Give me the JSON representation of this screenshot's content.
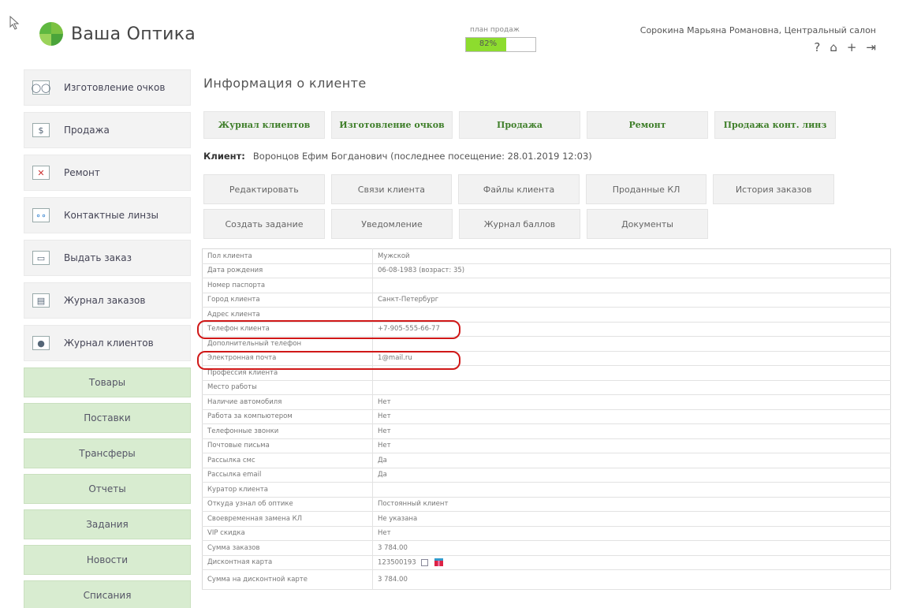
{
  "app": {
    "title": "Ваша Оптика"
  },
  "plan": {
    "label": "план продаж",
    "percent_text": "82%",
    "percent": 0.82
  },
  "user": {
    "name": "Сорокина Марьяна Романовна, Центральный салон"
  },
  "header_icons": [
    "help-icon",
    "home-icon",
    "plus-icon",
    "logout-icon"
  ],
  "sidebar": {
    "items": [
      {
        "label": "Изготовление очков",
        "icon": "glasses-icon",
        "glyph": "◯◯"
      },
      {
        "label": "Продажа",
        "icon": "sale-icon",
        "glyph": "$"
      },
      {
        "label": "Ремонт",
        "icon": "repair-icon",
        "glyph": "✕"
      },
      {
        "label": "Контактные линзы",
        "icon": "lens-icon",
        "glyph": "∘∘"
      },
      {
        "label": "Выдать заказ",
        "icon": "order-out-icon",
        "glyph": "▭"
      },
      {
        "label": "Журнал заказов",
        "icon": "orders-log-icon",
        "glyph": "▤"
      },
      {
        "label": "Журнал клиентов",
        "icon": "clients-log-icon",
        "glyph": "●"
      }
    ],
    "green_items": [
      "Товары",
      "Поставки",
      "Трансферы",
      "Отчеты",
      "Задания",
      "Новости",
      "Списания"
    ]
  },
  "main": {
    "title": "Информация о клиенте",
    "tabs": [
      "Журнал клиентов",
      "Изготовление очков",
      "Продажа",
      "Ремонт",
      "Продажа конт. линз"
    ],
    "client_label": "Клиент:",
    "client_text": "Воронцов Ефим Богданович (последнее посещение: 28.01.2019 12:03)",
    "actions_row1": [
      "Редактировать",
      "Связи клиента",
      "Файлы клиента",
      "Проданные КЛ",
      "История заказов"
    ],
    "actions_row2": [
      "Создать задание",
      "Уведомление",
      "Журнал баллов",
      "Документы"
    ]
  },
  "info_rows": [
    {
      "key": "Пол клиента",
      "value": "Мужской"
    },
    {
      "key": "Дата рождения",
      "value": "06-08-1983 (возраст: 35)"
    },
    {
      "key": "Номер паспорта",
      "value": ""
    },
    {
      "key": "Город клиента",
      "value": "Санкт-Петербург"
    },
    {
      "key": "Адрес клиента",
      "value": ""
    },
    {
      "key": "Телефон клиента",
      "value": "+7-905-555-66-77"
    },
    {
      "key": "Дополнительный телефон",
      "value": ""
    },
    {
      "key": "Электронная почта",
      "value": "1@mail.ru"
    },
    {
      "key": "Профессия клиента",
      "value": ""
    },
    {
      "key": "Место работы",
      "value": ""
    },
    {
      "key": "Наличие автомобиля",
      "value": "Нет"
    },
    {
      "key": "Работа за компьютером",
      "value": "Нет"
    },
    {
      "key": "Телефонные звонки",
      "value": "Нет"
    },
    {
      "key": "Почтовые письма",
      "value": "Нет"
    },
    {
      "key": "Рассылка смс",
      "value": "Да"
    },
    {
      "key": "Рассылка email",
      "value": "Да"
    },
    {
      "key": "Куратор клиента",
      "value": ""
    },
    {
      "key": "Откуда узнал об оптике",
      "value": "Постоянный клиент"
    },
    {
      "key": "Своевременная замена КЛ",
      "value": "Не указана"
    },
    {
      "key": "VIP скидка",
      "value": "Нет"
    },
    {
      "key": "Сумма заказов",
      "value": "3 784.00"
    },
    {
      "key": "Дисконтная карта",
      "value": "123500193"
    },
    {
      "key": "Сумма на дисконтной карте",
      "value": "3 784.00"
    }
  ],
  "colors": {
    "accent_green": "#8ddc2e",
    "tab_text": "#3f7f2a",
    "highlight": "#d01818"
  }
}
